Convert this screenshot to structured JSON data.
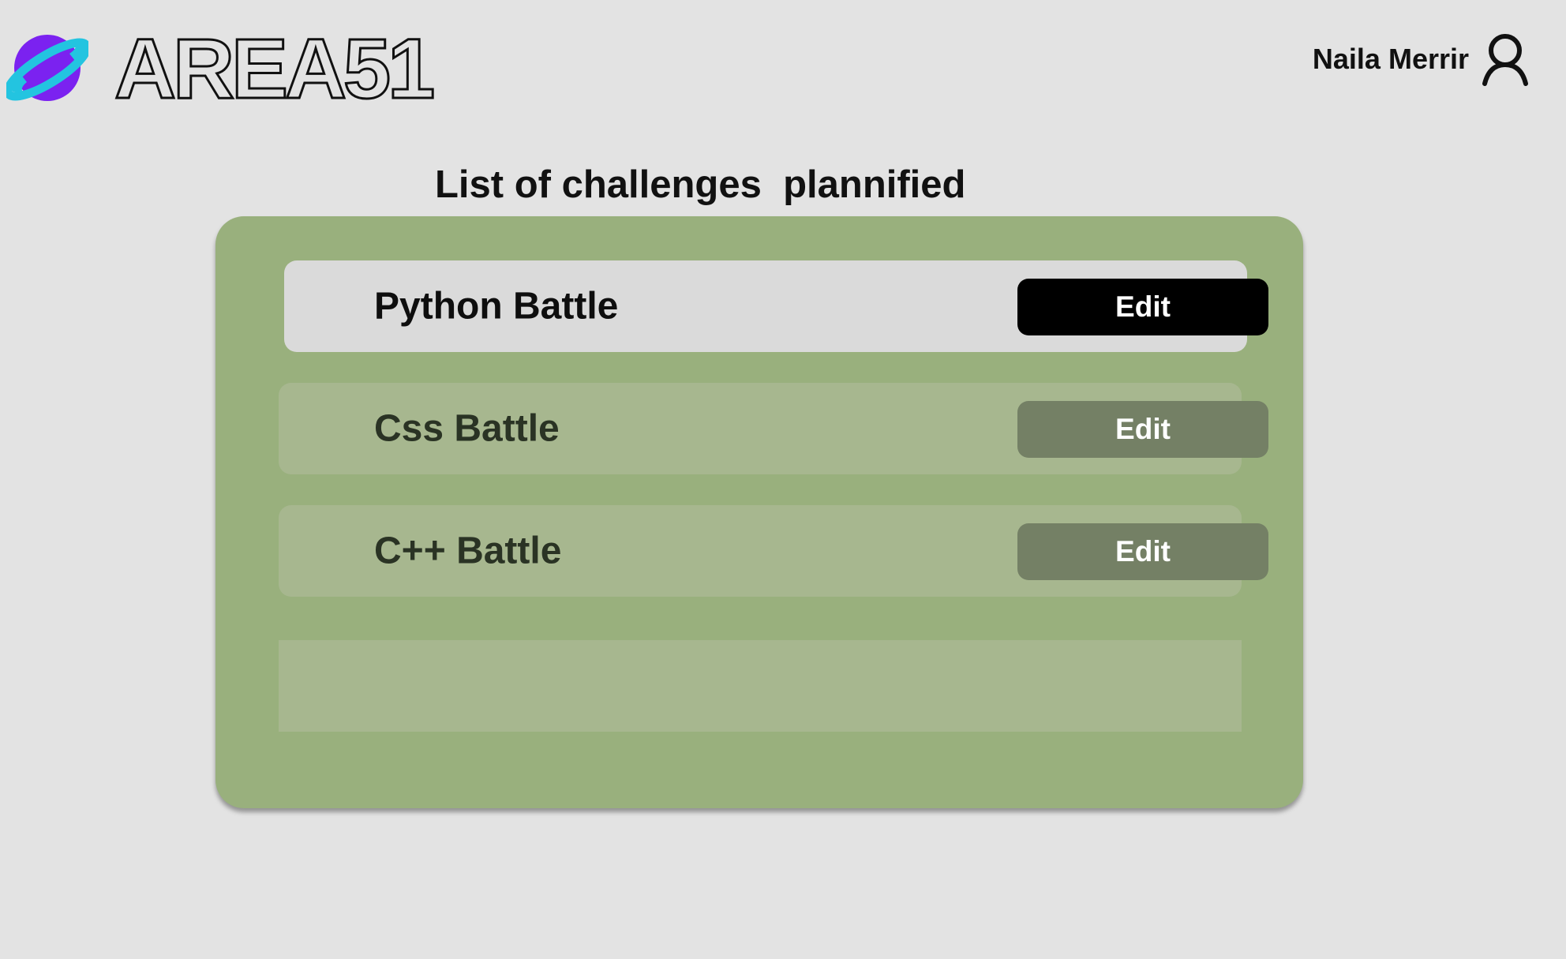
{
  "app": {
    "brand": "AREA51",
    "logo_icon": "planet-icon"
  },
  "user": {
    "name": "Naila Merrir",
    "icon": "user-icon"
  },
  "page": {
    "title": "List of challenges  plannified"
  },
  "challenges": [
    {
      "label": "Python Battle",
      "edit_label": "Edit",
      "selected": true
    },
    {
      "label": "Css Battle",
      "edit_label": "Edit",
      "selected": false
    },
    {
      "label": "C++ Battle",
      "edit_label": "Edit",
      "selected": false
    }
  ],
  "colors": {
    "background": "#e3e3e3",
    "panel": "#99b07d",
    "row": "#a7b78f",
    "row_selected": "#dadada",
    "button": "#748065",
    "button_selected": "#000000",
    "logo_primary": "#7b22f0",
    "logo_ring": "#23c4e0"
  }
}
